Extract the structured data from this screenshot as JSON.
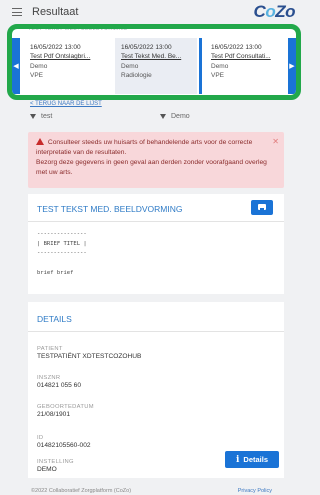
{
  "header": {
    "title": "Resultaat",
    "logo_left": "C",
    "logo_o": "o",
    "logo_right": "Zo"
  },
  "carousel": {
    "heading": "TEST TEKST MED. BEELDVORMING",
    "cards": [
      {
        "date": "16/05/2022 13:00",
        "name": "Test Pdf Ontslagbri...",
        "org": "Demo",
        "type": "VPE"
      },
      {
        "date": "16/05/2022 13:00",
        "name": "Test Tekst Med. Be...",
        "org": "Demo",
        "type": "Radiologie"
      },
      {
        "date": "16/05/2022 13:00",
        "name": "Test Pdf Consultati...",
        "org": "Demo",
        "type": "VPE"
      }
    ]
  },
  "back_link": "< TERUG NAAR DE LIJST",
  "filters": [
    {
      "label": "test"
    },
    {
      "label": "Demo"
    }
  ],
  "alert": {
    "line1": "Consulteer steeds uw huisarts of behandelende arts voor de correcte interpretatie van de resultaten.",
    "line2": "Bezorg deze gegevens in geen geval aan derden zonder voorafgaand overleg met uw arts."
  },
  "document": {
    "title": "TEST TEKST MED. BEELDVORMING",
    "body": "---------------\n| BRIEF TITEL |\n---------------\n\nbrief brief"
  },
  "details": {
    "title": "DETAILS",
    "fields": [
      {
        "label": "PATIENT",
        "value": "TESTPATIËNT XDTESTCOZOHUB"
      },
      {
        "label": "INSZNR",
        "value": "014821 055 60"
      },
      {
        "label": "GEBOORTEDATUM",
        "value": "21/08/1901"
      },
      {
        "label": "ID",
        "value": "01482105560-002"
      },
      {
        "label": "INSTELLING",
        "value": "DEMO"
      }
    ],
    "button_label": "Details"
  },
  "footer": {
    "copyright": "©2022 Collaboratief Zorgplatform (CoZo)",
    "privacy": "Privacy Policy"
  },
  "colors": {
    "accent": "#1a73d6",
    "highlight_border": "#22a84a",
    "alert_bg": "#f8d7da"
  }
}
